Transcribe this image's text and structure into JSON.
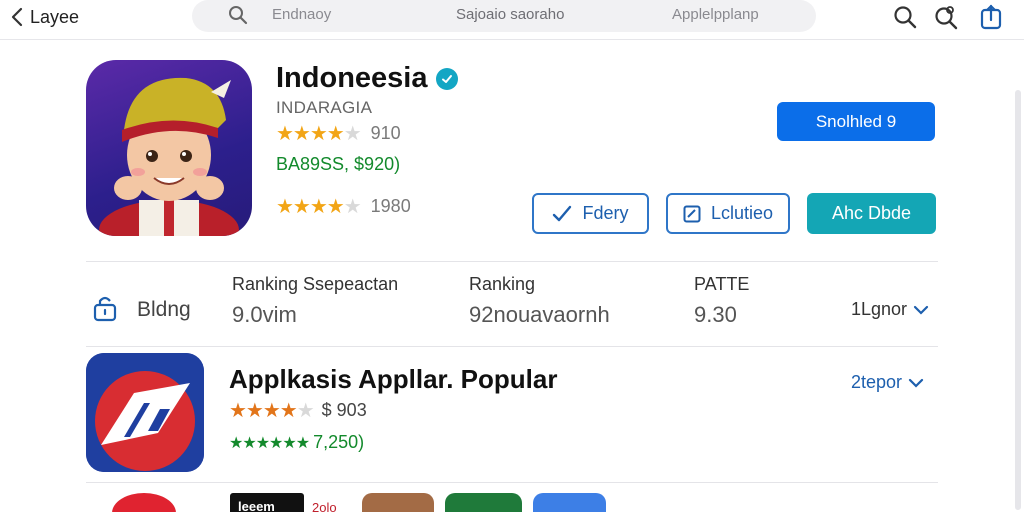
{
  "topbar": {
    "back_label": "Layee",
    "search_segments": [
      "Endnaoy",
      "Sajoaio saoraho",
      "Applelpplanp"
    ]
  },
  "app": {
    "title": "Indoneesia",
    "subtitle": "INDARAGIA",
    "rating_stars": 3.5,
    "rating_text": "910",
    "price_text": "BA89SS, $920)",
    "rating2_stars": 4,
    "rating2_text": "1980",
    "primary_button": "Snolhled 9",
    "buttons": [
      "Fdery",
      "Lclutieo",
      "Ahc Dbde"
    ]
  },
  "stats": {
    "left_label": "Bldng",
    "items": [
      {
        "label": "Ranking Ssepeactan",
        "value": "9.0vim"
      },
      {
        "label": "Ranking",
        "value": "92nouavaornh"
      },
      {
        "label": "PATTE",
        "value": "9.30"
      }
    ],
    "more_label": "1Lgnor"
  },
  "popular": {
    "title": "Applkasis Appllar. Popular",
    "rating_stars": 3.5,
    "price_text": "$ 903",
    "reviews_text": "7,250)",
    "more_label": "2tepor"
  },
  "bottom": {
    "chip_text": "leeem",
    "side_text": "2olo"
  },
  "colors": {
    "primary_blue": "#0b6ee9",
    "teal": "#14a6b5",
    "star": "#f2a516",
    "green": "#138a2c"
  }
}
